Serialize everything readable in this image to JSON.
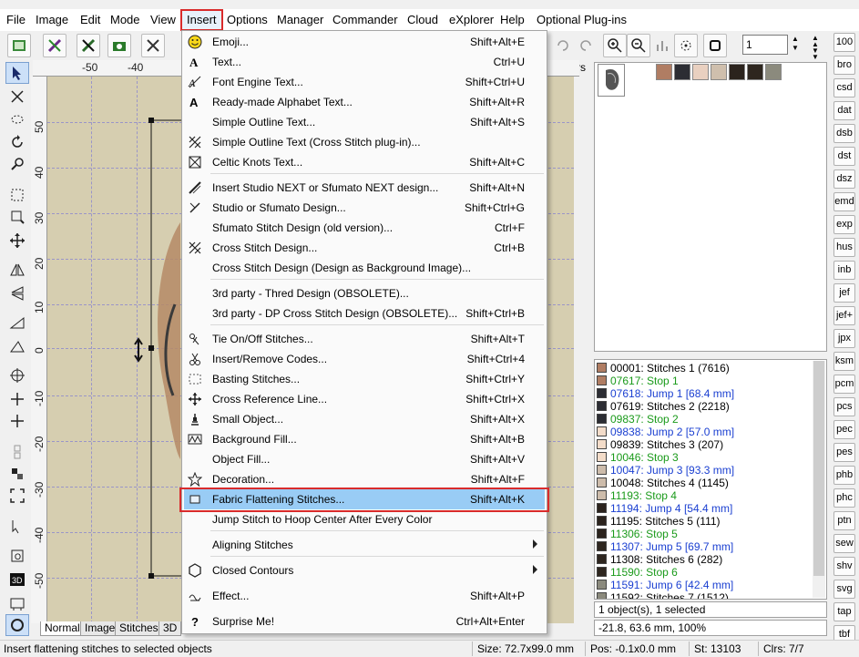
{
  "menubar": {
    "items": [
      "File",
      "Image",
      "Edit",
      "Mode",
      "View",
      "Insert",
      "Options",
      "Manager",
      "Commander",
      "Cloud",
      "eXplorer",
      "Help",
      "Optional Plug-ins"
    ],
    "active": "Insert"
  },
  "toolbar": {
    "zoom_value": "1",
    "units_fragment": "limeters"
  },
  "ruler": {
    "top_labels": [
      "-50",
      "-40"
    ],
    "left_labels": [
      "50",
      "40",
      "30",
      "20",
      "10",
      "0",
      "-10",
      "-20",
      "-30",
      "-40",
      "-50"
    ]
  },
  "tabs": [
    "Normal",
    "Image",
    "Stitches",
    "3D"
  ],
  "insert_menu": {
    "items": [
      {
        "label": "Emoji...",
        "shortcut": "Shift+Alt+E",
        "icon": "smiley-icon"
      },
      {
        "label": "Text...",
        "shortcut": "Ctrl+U",
        "icon": "text-a-icon"
      },
      {
        "label": "Font Engine Text...",
        "shortcut": "Shift+Ctrl+U",
        "icon": "font-engine-icon"
      },
      {
        "label": "Ready-made Alphabet Text...",
        "shortcut": "Shift+Alt+R",
        "icon": "alphabet-icon"
      },
      {
        "label": "Simple Outline Text...",
        "shortcut": "Shift+Alt+S",
        "icon": ""
      },
      {
        "label": "Simple Outline Text (Cross Stitch plug-in)...",
        "shortcut": "",
        "icon": "cross-stitch-icon"
      },
      {
        "label": "Celtic Knots Text...",
        "shortcut": "Shift+Alt+C",
        "icon": "celtic-knot-icon"
      },
      {
        "label": "Insert Studio NEXT or Sfumato NEXT design...",
        "shortcut": "Shift+Alt+N",
        "icon": "needle-icon"
      },
      {
        "label": "Studio or Sfumato Design...",
        "shortcut": "Shift+Ctrl+G",
        "icon": "needle-small-icon"
      },
      {
        "label": "Sfumato Stitch Design (old version)...",
        "shortcut": "Ctrl+F",
        "icon": ""
      },
      {
        "label": "Cross Stitch Design...",
        "shortcut": "Ctrl+B",
        "icon": "cross-stitch-icon"
      },
      {
        "label": "Cross Stitch Design (Design as Background Image)...",
        "shortcut": "",
        "icon": ""
      },
      {
        "label": "3rd party - Thred Design (OBSOLETE)...",
        "shortcut": "",
        "icon": ""
      },
      {
        "label": "3rd party - DP Cross Stitch Design (OBSOLETE)...",
        "shortcut": "Shift+Ctrl+B",
        "icon": ""
      },
      {
        "label": "Tie On/Off Stitches...",
        "shortcut": "Shift+Alt+T",
        "icon": "tie-stitch-icon"
      },
      {
        "label": "Insert/Remove Codes...",
        "shortcut": "Shift+Ctrl+4",
        "icon": "scissors-icon"
      },
      {
        "label": "Basting Stitches...",
        "shortcut": "Shift+Ctrl+Y",
        "icon": "basting-icon"
      },
      {
        "label": "Cross Reference Line...",
        "shortcut": "Shift+Ctrl+X",
        "icon": "cross-arrows-icon"
      },
      {
        "label": "Small Object...",
        "shortcut": "Shift+Alt+X",
        "icon": "small-object-icon"
      },
      {
        "label": "Background Fill...",
        "shortcut": "Shift+Alt+B",
        "icon": "background-fill-icon"
      },
      {
        "label": "Object Fill...",
        "shortcut": "Shift+Alt+V",
        "icon": ""
      },
      {
        "label": "Decoration...",
        "shortcut": "Shift+Alt+F",
        "icon": "star-icon"
      },
      {
        "label": "Fabric Flattening Stitches...",
        "shortcut": "Shift+Alt+K",
        "icon": "flatten-rect-icon"
      },
      {
        "label": "Jump Stitch to Hoop Center After Every Color",
        "shortcut": "",
        "icon": ""
      },
      {
        "label": "Aligning Stitches",
        "shortcut": "",
        "icon": "",
        "submenu": true
      },
      {
        "label": "Closed Contours",
        "shortcut": "",
        "icon": "hexagon-icon",
        "submenu": true
      },
      {
        "label": "Effect...",
        "shortcut": "Shift+Alt+P",
        "icon": "effect-icon"
      },
      {
        "label": "Surprise Me!",
        "shortcut": "Ctrl+Alt+Enter",
        "icon": "question-icon"
      }
    ],
    "highlighted": "Fabric Flattening Stitches..."
  },
  "palette": {
    "swatches": [
      "#b07d63",
      "#2c2d33",
      "#e9d0c0",
      "#cfbfad",
      "#2b231d",
      "#2e261f",
      "#8b8a7d"
    ]
  },
  "color_list": [
    {
      "text": "00001: Stitches 1 (7616)",
      "kind": "stitch",
      "color": "#b07d63"
    },
    {
      "text": "07617: Stop 1",
      "kind": "stop",
      "color": "#b07d63"
    },
    {
      "text": "07618: Jump 1 [68.4 mm]",
      "kind": "jump",
      "color": "#2c2d33"
    },
    {
      "text": "07619: Stitches 2 (2218)",
      "kind": "stitch",
      "color": "#2c2d33"
    },
    {
      "text": "09837: Stop 2",
      "kind": "stop",
      "color": "#2c2d33"
    },
    {
      "text": "09838: Jump 2 [57.0 mm]",
      "kind": "jump",
      "color": "#f3dcc9"
    },
    {
      "text": "09839: Stitches 3 (207)",
      "kind": "stitch",
      "color": "#f3dcc9"
    },
    {
      "text": "10046: Stop 3",
      "kind": "stop",
      "color": "#f3dcc9"
    },
    {
      "text": "10047: Jump 3 [93.3 mm]",
      "kind": "jump",
      "color": "#cdbcab"
    },
    {
      "text": "10048: Stitches 4 (1145)",
      "kind": "stitch",
      "color": "#cdbcab"
    },
    {
      "text": "11193: Stop 4",
      "kind": "stop",
      "color": "#cdbcab"
    },
    {
      "text": "11194: Jump 4 [54.4 mm]",
      "kind": "jump",
      "color": "#2b231d"
    },
    {
      "text": "11195: Stitches 5 (111)",
      "kind": "stitch",
      "color": "#2b231d"
    },
    {
      "text": "11306: Stop 5",
      "kind": "stop",
      "color": "#2b231d"
    },
    {
      "text": "11307: Jump 5 [69.7 mm]",
      "kind": "jump",
      "color": "#2e261f"
    },
    {
      "text": "11308: Stitches 6 (282)",
      "kind": "stitch",
      "color": "#2e261f"
    },
    {
      "text": "11590: Stop 6",
      "kind": "stop",
      "color": "#2e261f"
    },
    {
      "text": "11591: Jump 6 [42.4 mm]",
      "kind": "jump",
      "color": "#8b8a7d"
    },
    {
      "text": "11592: Stitches 7 (1512)",
      "kind": "stitch",
      "color": "#8b8a7d"
    }
  ],
  "info": {
    "selection": "1 object(s), 1 selected",
    "coords": "-21.8, 63.6 mm, 100%"
  },
  "filetypes": [
    "100",
    "bro",
    "csd",
    "dat",
    "dsb",
    "dst",
    "dsz",
    "emd",
    "exp",
    "hus",
    "inb",
    "jef",
    "jef+",
    "jpx",
    "ksm",
    "pcm",
    "pcs",
    "pec",
    "pes",
    "phb",
    "phc",
    "ptn",
    "sew",
    "shv",
    "svg",
    "tap",
    "tbf"
  ],
  "status": {
    "hint": "Insert flattening stitches to selected objects",
    "size": "Size: 72.7x99.0 mm",
    "pos": "Pos: -0.1x0.0 mm",
    "st": "St: 13103",
    "clrs": "Clrs: 7/7"
  },
  "colors": {
    "highlight": "#99ccf5",
    "red_outline": "#d92b2b",
    "canvas": "#d6ceb0"
  }
}
